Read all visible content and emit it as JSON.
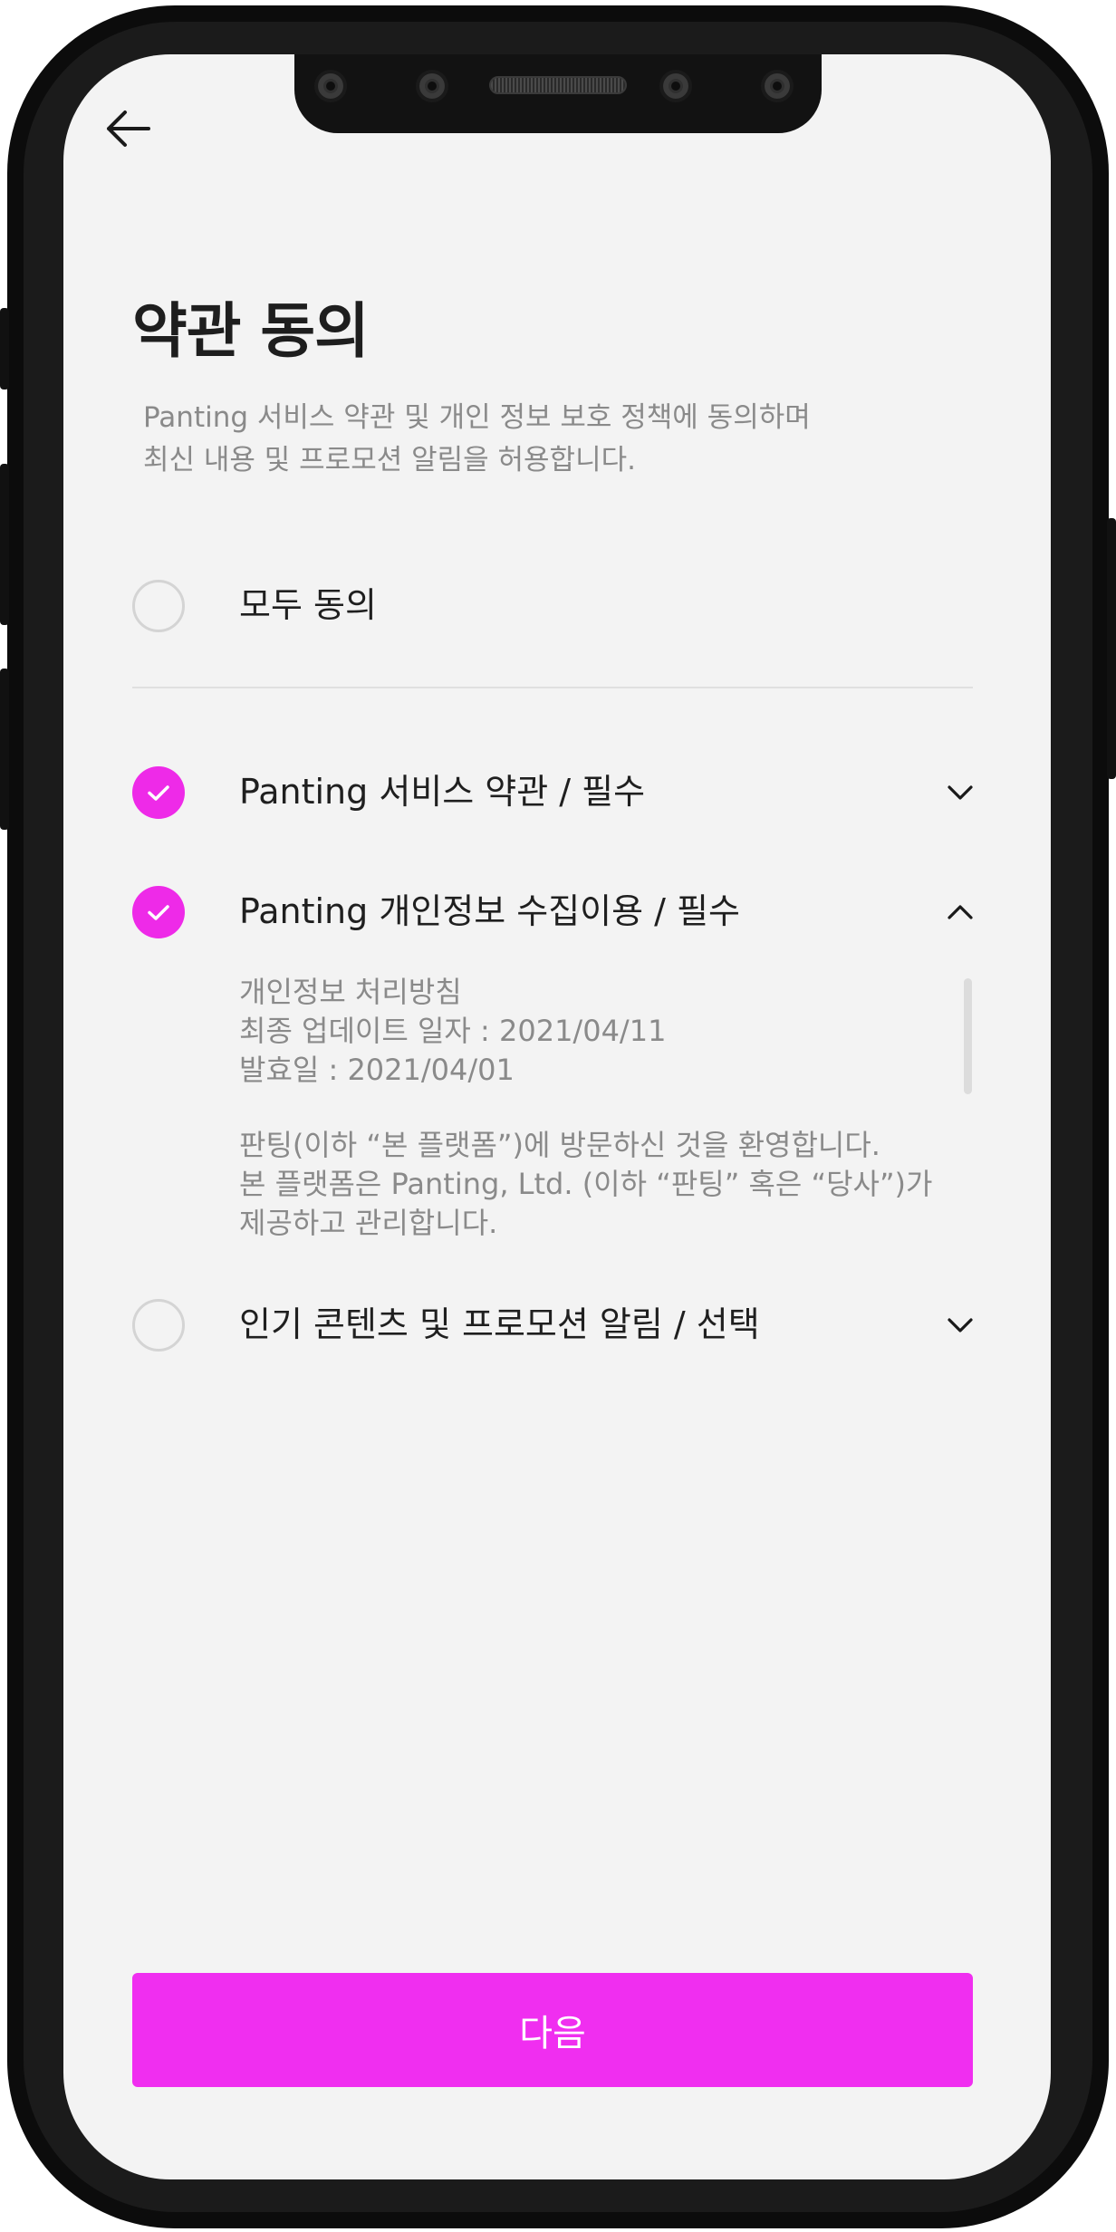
{
  "header": {
    "back_icon": "back-arrow-icon"
  },
  "title": "약관 동의",
  "description": {
    "line1": "Panting 서비스 약관 및 개인 정보 보호 정책에 동의하며",
    "line2": "최신 내용 및 프로모션 알림을 허용합니다."
  },
  "agree_all": {
    "label": "모두 동의",
    "checked": false
  },
  "terms": [
    {
      "label": "Panting 서비스 약관 / 필수",
      "checked": true,
      "expanded": false
    },
    {
      "label": "Panting 개인정보 수집이용 / 필수",
      "checked": true,
      "expanded": true,
      "detail": {
        "line1": "개인정보 처리방침",
        "line2": "최종 업데이트 일자 : 2021/04/11",
        "line3": "발효일 : 2021/04/01",
        "line4": "판팅(이하 “본 플랫폼”)에 방문하신 것을 환영합니다.",
        "line5": "본 플랫폼은 Panting, Ltd. (이하 “판팅” 혹은 “당사”)가",
        "line6": "제공하고 관리합니다."
      }
    },
    {
      "label": "인기 콘텐츠 및 프로모션 알림 / 선택",
      "checked": false,
      "expanded": false
    }
  ],
  "next_button": {
    "label": "다음"
  },
  "colors": {
    "accent": "#ee2ae8",
    "button": "#f02ef0",
    "screen_bg": "#f3f3f3",
    "text_primary": "#1f1f1f",
    "text_secondary": "#8a8a8a"
  }
}
